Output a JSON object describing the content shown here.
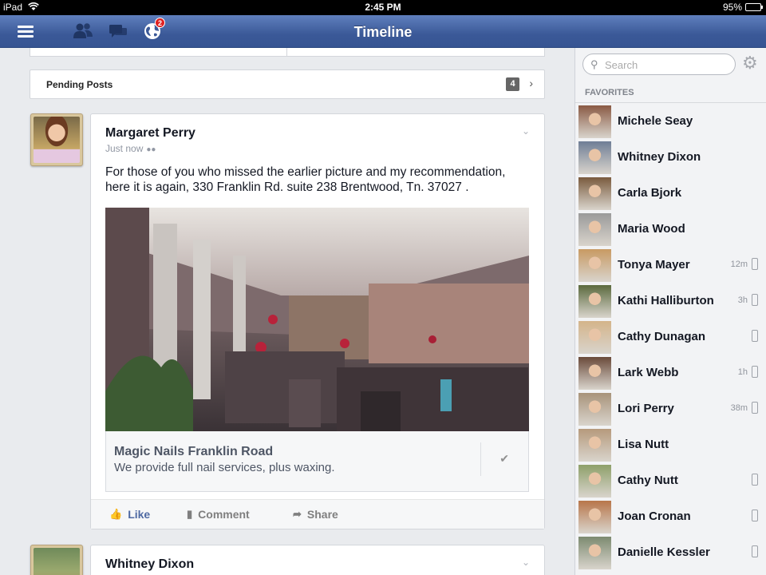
{
  "status_bar": {
    "device": "iPad",
    "time": "2:45 PM",
    "battery": "95%"
  },
  "nav": {
    "title": "Timeline",
    "notifications_count": "2"
  },
  "pending": {
    "label": "Pending Posts",
    "count": "4"
  },
  "post1": {
    "author": "Margaret Perry",
    "time": "Just now",
    "text": "For those of you who missed the earlier picture and my recommendation, here it is again, 330 Franklin Rd. suite 238 Brentwood, Tn. 37027 .",
    "link_title": "Magic Nails Franklin Road",
    "link_desc": "We provide full nail services, plus waxing."
  },
  "actions": {
    "like": "Like",
    "comment": "Comment",
    "share": "Share"
  },
  "post2": {
    "author": "Whitney Dixon"
  },
  "sidebar": {
    "search_placeholder": "Search",
    "favorites_header": "FAVORITES",
    "contacts": [
      {
        "name": "Michele Seay",
        "status": "",
        "mobile": false,
        "color": "#8a5a44"
      },
      {
        "name": "Whitney Dixon",
        "status": "",
        "mobile": false,
        "color": "#6f7e96"
      },
      {
        "name": "Carla Bjork",
        "status": "",
        "mobile": false,
        "color": "#7a5b3e"
      },
      {
        "name": "Maria Wood",
        "status": "",
        "mobile": false,
        "color": "#9a9a9a"
      },
      {
        "name": "Tonya Mayer",
        "status": "12m",
        "mobile": true,
        "color": "#c89a63"
      },
      {
        "name": "Kathi Halliburton",
        "status": "3h",
        "mobile": true,
        "color": "#5b6a3e"
      },
      {
        "name": "Cathy Dunagan",
        "status": "",
        "mobile": true,
        "color": "#d4b48a"
      },
      {
        "name": "Lark Webb",
        "status": "1h",
        "mobile": true,
        "color": "#6a4a3a"
      },
      {
        "name": "Lori Perry",
        "status": "38m",
        "mobile": true,
        "color": "#a8937a"
      },
      {
        "name": "Lisa Nutt",
        "status": "",
        "mobile": false,
        "color": "#b69a7c"
      },
      {
        "name": "Cathy Nutt",
        "status": "",
        "mobile": true,
        "color": "#8ea06a"
      },
      {
        "name": "Joan Cronan",
        "status": "",
        "mobile": true,
        "color": "#b8764a"
      },
      {
        "name": "Danielle Kessler",
        "status": "",
        "mobile": true,
        "color": "#7c8a70"
      }
    ]
  },
  "colors": {
    "nav": "#3b5998",
    "like": "#4f6aa3",
    "background": "#e9ebee"
  }
}
